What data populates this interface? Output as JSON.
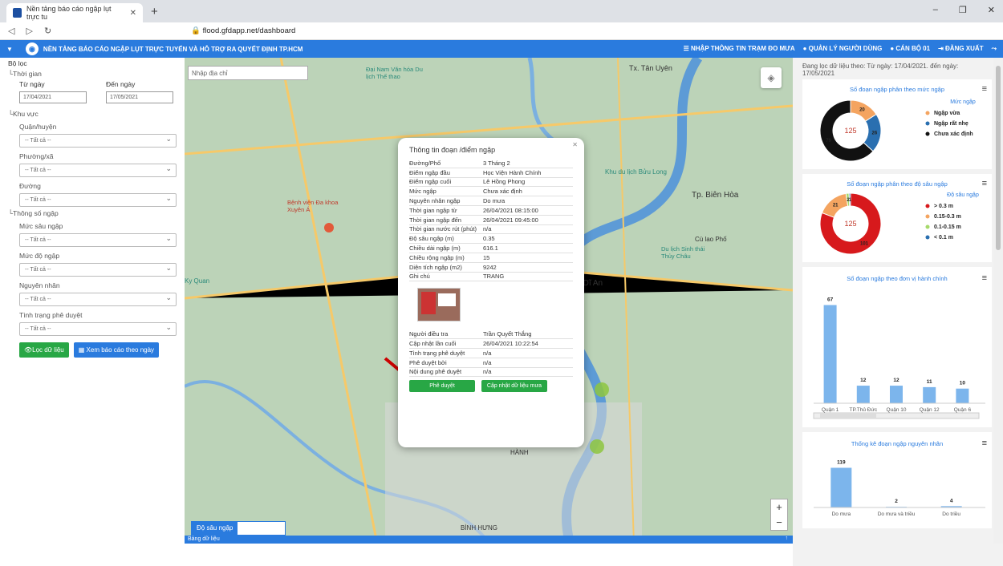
{
  "browser": {
    "tab_title": "Nền tảng báo cáo ngập lụt trực tu",
    "url": "flood.gfdapp.net/dashboard"
  },
  "appbar": {
    "title": "NỀN TẢNG BÁO CÁO NGẬP LỤT TRỰC TUYẾN VÀ HỖ TRỢ RA QUYẾT ĐỊNH TP.HCM",
    "links": [
      "NHẬP THÔNG TIN TRẠM ĐO MƯA",
      "QUẢN LÝ NGƯỜI DÙNG",
      "CÁN BỘ 01",
      "ĐĂNG XUẤT"
    ]
  },
  "filter": {
    "title": "Bộ lọc",
    "time_group": "Thời gian",
    "from_label": "Từ ngày",
    "to_label": "Đến ngày",
    "from_value": "17/04/2021",
    "to_value": "17/05/2021",
    "area_group": "Khu vực",
    "district": "Quận/huyện",
    "ward": "Phường/xã",
    "street": "Đường",
    "params_group": "Thông số ngập",
    "depth": "Mức sâu ngập",
    "level": "Mức độ ngập",
    "cause": "Nguyên nhân",
    "status": "Tình trạng phê duyệt",
    "all": "-- Tất cả --",
    "btn_filter": "Lọc dữ liệu",
    "btn_report": "Xem báo cáo theo ngày"
  },
  "map": {
    "search_placeholder": "Nhập địa chỉ",
    "legend_tab": "Độ sâu ngập",
    "data_tab": "Bảng dữ liệu",
    "labels": [
      "Tx. Tân Uyên",
      "Tp. Biên Hòa",
      "Tx. Dĩ An",
      "Khu du lịch Bửu Long",
      "Đại Nam Văn hóa Du lịch Thế thao",
      "Bệnh viện Đa khoa Xuyên Á",
      "Ky Quan",
      "BÌNH HƯNG",
      "HÀNH",
      "Cù lao Phố",
      "Du lịch Sinh thái Thủy Châu"
    ]
  },
  "popup": {
    "title": "Thông tin đoạn /điểm ngập",
    "rows": [
      [
        "Đường/Phố",
        "3 Tháng 2"
      ],
      [
        "Điểm ngập đầu",
        "Học Viện Hành Chính"
      ],
      [
        "Điểm ngập cuối",
        "Lê Hồng Phong"
      ],
      [
        "Mức ngập",
        "Chưa xác định"
      ],
      [
        "Nguyên nhân ngập",
        "Do mưa"
      ],
      [
        "Thời gian ngập từ",
        "26/04/2021 08:15:00"
      ],
      [
        "Thời gian ngập đến",
        "26/04/2021 09:45:00"
      ],
      [
        "Thời gian nước rút (phút)",
        "n/a"
      ],
      [
        "Độ sâu ngập (m)",
        "0.35"
      ],
      [
        "Chiều dài ngập (m)",
        "616.1"
      ],
      [
        "Chiều rộng ngập (m)",
        "15"
      ],
      [
        "Diện tích ngập (m2)",
        "9242"
      ],
      [
        "Ghi chú",
        "TRANG"
      ]
    ],
    "rows2": [
      [
        "Người điều tra",
        "Trần Quyết Thắng"
      ],
      [
        "Cập nhật lần cuối",
        "26/04/2021 10:22:54"
      ],
      [
        "Tình trạng phê duyệt",
        "n/a"
      ],
      [
        "Phê duyệt bởi",
        "n/a"
      ],
      [
        "Nội dung phê duyệt",
        "n/a"
      ]
    ],
    "btn_approve": "Phê duyệt",
    "btn_update": "Cập nhật dữ liệu mưa"
  },
  "right": {
    "filter_text": "Đang lọc dữ liệu theo: Từ ngày: 17/04/2021. đến ngày: 17/05/2021"
  },
  "chart_data": [
    {
      "type": "pie",
      "title": "Số đoạn ngập phân theo mức ngập",
      "legend_title": "Mức ngập",
      "center": "125",
      "slices": [
        {
          "name": "Ngập vừa",
          "value": 20,
          "color": "#f4a460"
        },
        {
          "name": "Ngập rất nhẹ",
          "value": 26,
          "color": "#2a6fb0"
        },
        {
          "name": "Chưa xác định",
          "value": 79,
          "color": "#111111"
        }
      ]
    },
    {
      "type": "pie",
      "title": "Số đoạn ngập phân theo độ sâu ngập",
      "legend_title": "Độ sâu ngập",
      "center": "125",
      "slices": [
        {
          "name": "> 0.3 m",
          "value": 101,
          "color": "#d7191c"
        },
        {
          "name": "0.15-0.3 m",
          "value": 21,
          "color": "#f4a460"
        },
        {
          "name": "0.1-0.15 m",
          "value": 2,
          "color": "#a6d96a"
        },
        {
          "name": "< 0.1 m",
          "value": 1,
          "color": "#2a6fb0"
        }
      ]
    },
    {
      "type": "bar",
      "title": "Số đoạn ngập theo đơn vị hành chính",
      "categories": [
        "Quận 1",
        "TP.Thủ Đức",
        "Quận 10",
        "Quận 12",
        "Quận 6"
      ],
      "values": [
        67,
        12,
        12,
        11,
        10
      ],
      "ylim": [
        0,
        70
      ],
      "color": "#7cb5ec"
    },
    {
      "type": "bar",
      "title": "Thống kê đoạn ngập nguyên nhân",
      "categories": [
        "Do mưa",
        "Do mưa và triều",
        "Do triều"
      ],
      "values": [
        119,
        2,
        4
      ],
      "ylim": [
        0,
        125
      ],
      "color": "#7cb5ec"
    }
  ]
}
